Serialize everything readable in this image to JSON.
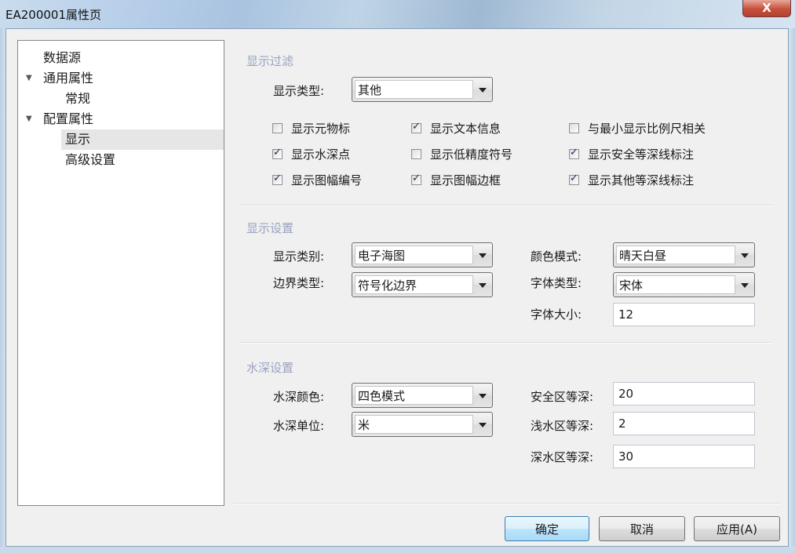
{
  "window": {
    "title": "EA200001属性页",
    "close_label": "X"
  },
  "tree": {
    "items": [
      {
        "label": "数据源"
      },
      {
        "label": "通用属性",
        "expander": "▼"
      },
      {
        "label": "常规"
      },
      {
        "label": "配置属性",
        "expander": "▼"
      },
      {
        "label": "显示",
        "selected": true
      },
      {
        "label": "高级设置"
      }
    ]
  },
  "display_filter": {
    "title": "显示过滤",
    "type_label": "显示类型:",
    "type_value": "其他",
    "checkboxes": [
      {
        "label": "显示元物标",
        "checked": false
      },
      {
        "label": "显示文本信息",
        "checked": true
      },
      {
        "label": "与最小显示比例尺相关",
        "checked": false
      },
      {
        "label": "显示水深点",
        "checked": true
      },
      {
        "label": "显示低精度符号",
        "checked": false
      },
      {
        "label": "显示安全等深线标注",
        "checked": true
      },
      {
        "label": "显示图幅编号",
        "checked": true
      },
      {
        "label": "显示图幅边框",
        "checked": true
      },
      {
        "label": "显示其他等深线标注",
        "checked": true
      }
    ]
  },
  "display_settings": {
    "title": "显示设置",
    "category_label": "显示类别:",
    "category_value": "电子海图",
    "boundary_label": "边界类型:",
    "boundary_value": "符号化边界",
    "color_mode_label": "颜色模式:",
    "color_mode_value": "晴天白昼",
    "font_type_label": "字体类型:",
    "font_type_value": "宋体",
    "font_size_label": "字体大小:",
    "font_size_value": "12"
  },
  "depth_settings": {
    "title": "水深设置",
    "color_label": "水深颜色:",
    "color_value": "四色模式",
    "unit_label": "水深单位:",
    "unit_value": "米",
    "safe_label": "安全区等深:",
    "safe_value": "20",
    "shallow_label": "浅水区等深:",
    "shallow_value": "2",
    "deep_label": "深水区等深:",
    "deep_value": "30"
  },
  "buttons": {
    "ok": "确定",
    "cancel": "取消",
    "apply": "应用(A)"
  }
}
